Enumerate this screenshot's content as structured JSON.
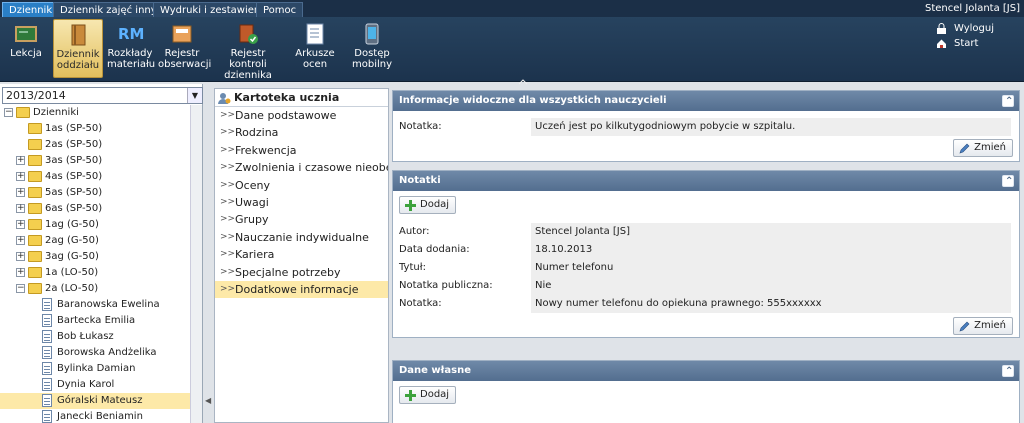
{
  "top_tabs": [
    "Dziennik",
    "Dziennik zajęć innych",
    "Wydruki i zestawienia",
    "Pomoc"
  ],
  "user_name": "Stencel Jolanta [JS]",
  "toolbar": {
    "items": [
      {
        "label1": "Lekcja",
        "label2": ""
      },
      {
        "label1": "Dziennik",
        "label2": "oddziału"
      },
      {
        "label1": "Rozkłady",
        "label2": "materiału"
      },
      {
        "label1": "Rejestr",
        "label2": "obserwacji"
      },
      {
        "label1": "Rejestr kontroli",
        "label2": "dziennika"
      },
      {
        "label1": "Arkusze",
        "label2": "ocen"
      },
      {
        "label1": "Dostęp",
        "label2": "mobilny"
      }
    ],
    "rm_text": "RM",
    "logout": "Wyloguj",
    "start": "Start"
  },
  "year": "2013/2014",
  "tree": {
    "root": "Dzienniki",
    "classes": [
      "1as (SP-50)",
      "2as (SP-50)",
      "3as (SP-50)",
      "4as (SP-50)",
      "5as (SP-50)",
      "6as (SP-50)",
      "1ag (G-50)",
      "2ag (G-50)",
      "3ag (G-50)",
      "1a (LO-50)",
      "2a (LO-50)"
    ],
    "students": [
      "Baranowska Ewelina",
      "Bartecka Emilia",
      "Bob Łukasz",
      "Borowska Andżelika",
      "Bylinka Damian",
      "Dynia Karol",
      "Góralski Mateusz",
      "Janecki Beniamin"
    ]
  },
  "card": {
    "title": "Kartoteka ucznia",
    "items": [
      "Dane podstawowe",
      "Rodzina",
      "Frekwencja",
      "Zwolnienia i czasowe nieobecności",
      "Oceny",
      "Uwagi",
      "Grupy",
      "Nauczanie indywidualne",
      "Kariera",
      "Specjalne potrzeby",
      "Dodatkowe informacje"
    ],
    "selected": 10
  },
  "info": {
    "title": "Informacje widoczne dla wszystkich nauczycieli",
    "note_label": "Notatka:",
    "note_value": "Uczeń jest po kilkutygodniowym pobycie w szpitalu.",
    "edit": "Zmień"
  },
  "notes": {
    "title": "Notatki",
    "add": "Dodaj",
    "rows": [
      {
        "label": "Autor:",
        "value": "Stencel Jolanta  [JS]"
      },
      {
        "label": "Data dodania:",
        "value": "18.10.2013"
      },
      {
        "label": "Tytuł:",
        "value": "Numer telefonu"
      },
      {
        "label": "Notatka publiczna:",
        "value": "Nie"
      },
      {
        "label": "Notatka:",
        "value": "Nowy numer telefonu do opiekuna prawnego: 555xxxxxx"
      }
    ],
    "edit": "Zmień"
  },
  "own": {
    "title": "Dane własne",
    "add": "Dodaj"
  }
}
